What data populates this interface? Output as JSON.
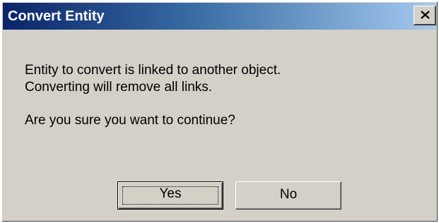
{
  "dialog": {
    "title": "Convert Entity",
    "close_icon": "close-x-icon",
    "message_line1": "Entity to convert is linked to another object.",
    "message_line2": "Converting will remove all links.",
    "question": "Are you sure you want to continue?",
    "yes_label": "Yes",
    "no_label": "No"
  },
  "colors": {
    "face": "#d4d0c8",
    "title_start": "#0a246a",
    "title_end": "#a6caf0",
    "title_text": "#ffffff"
  }
}
